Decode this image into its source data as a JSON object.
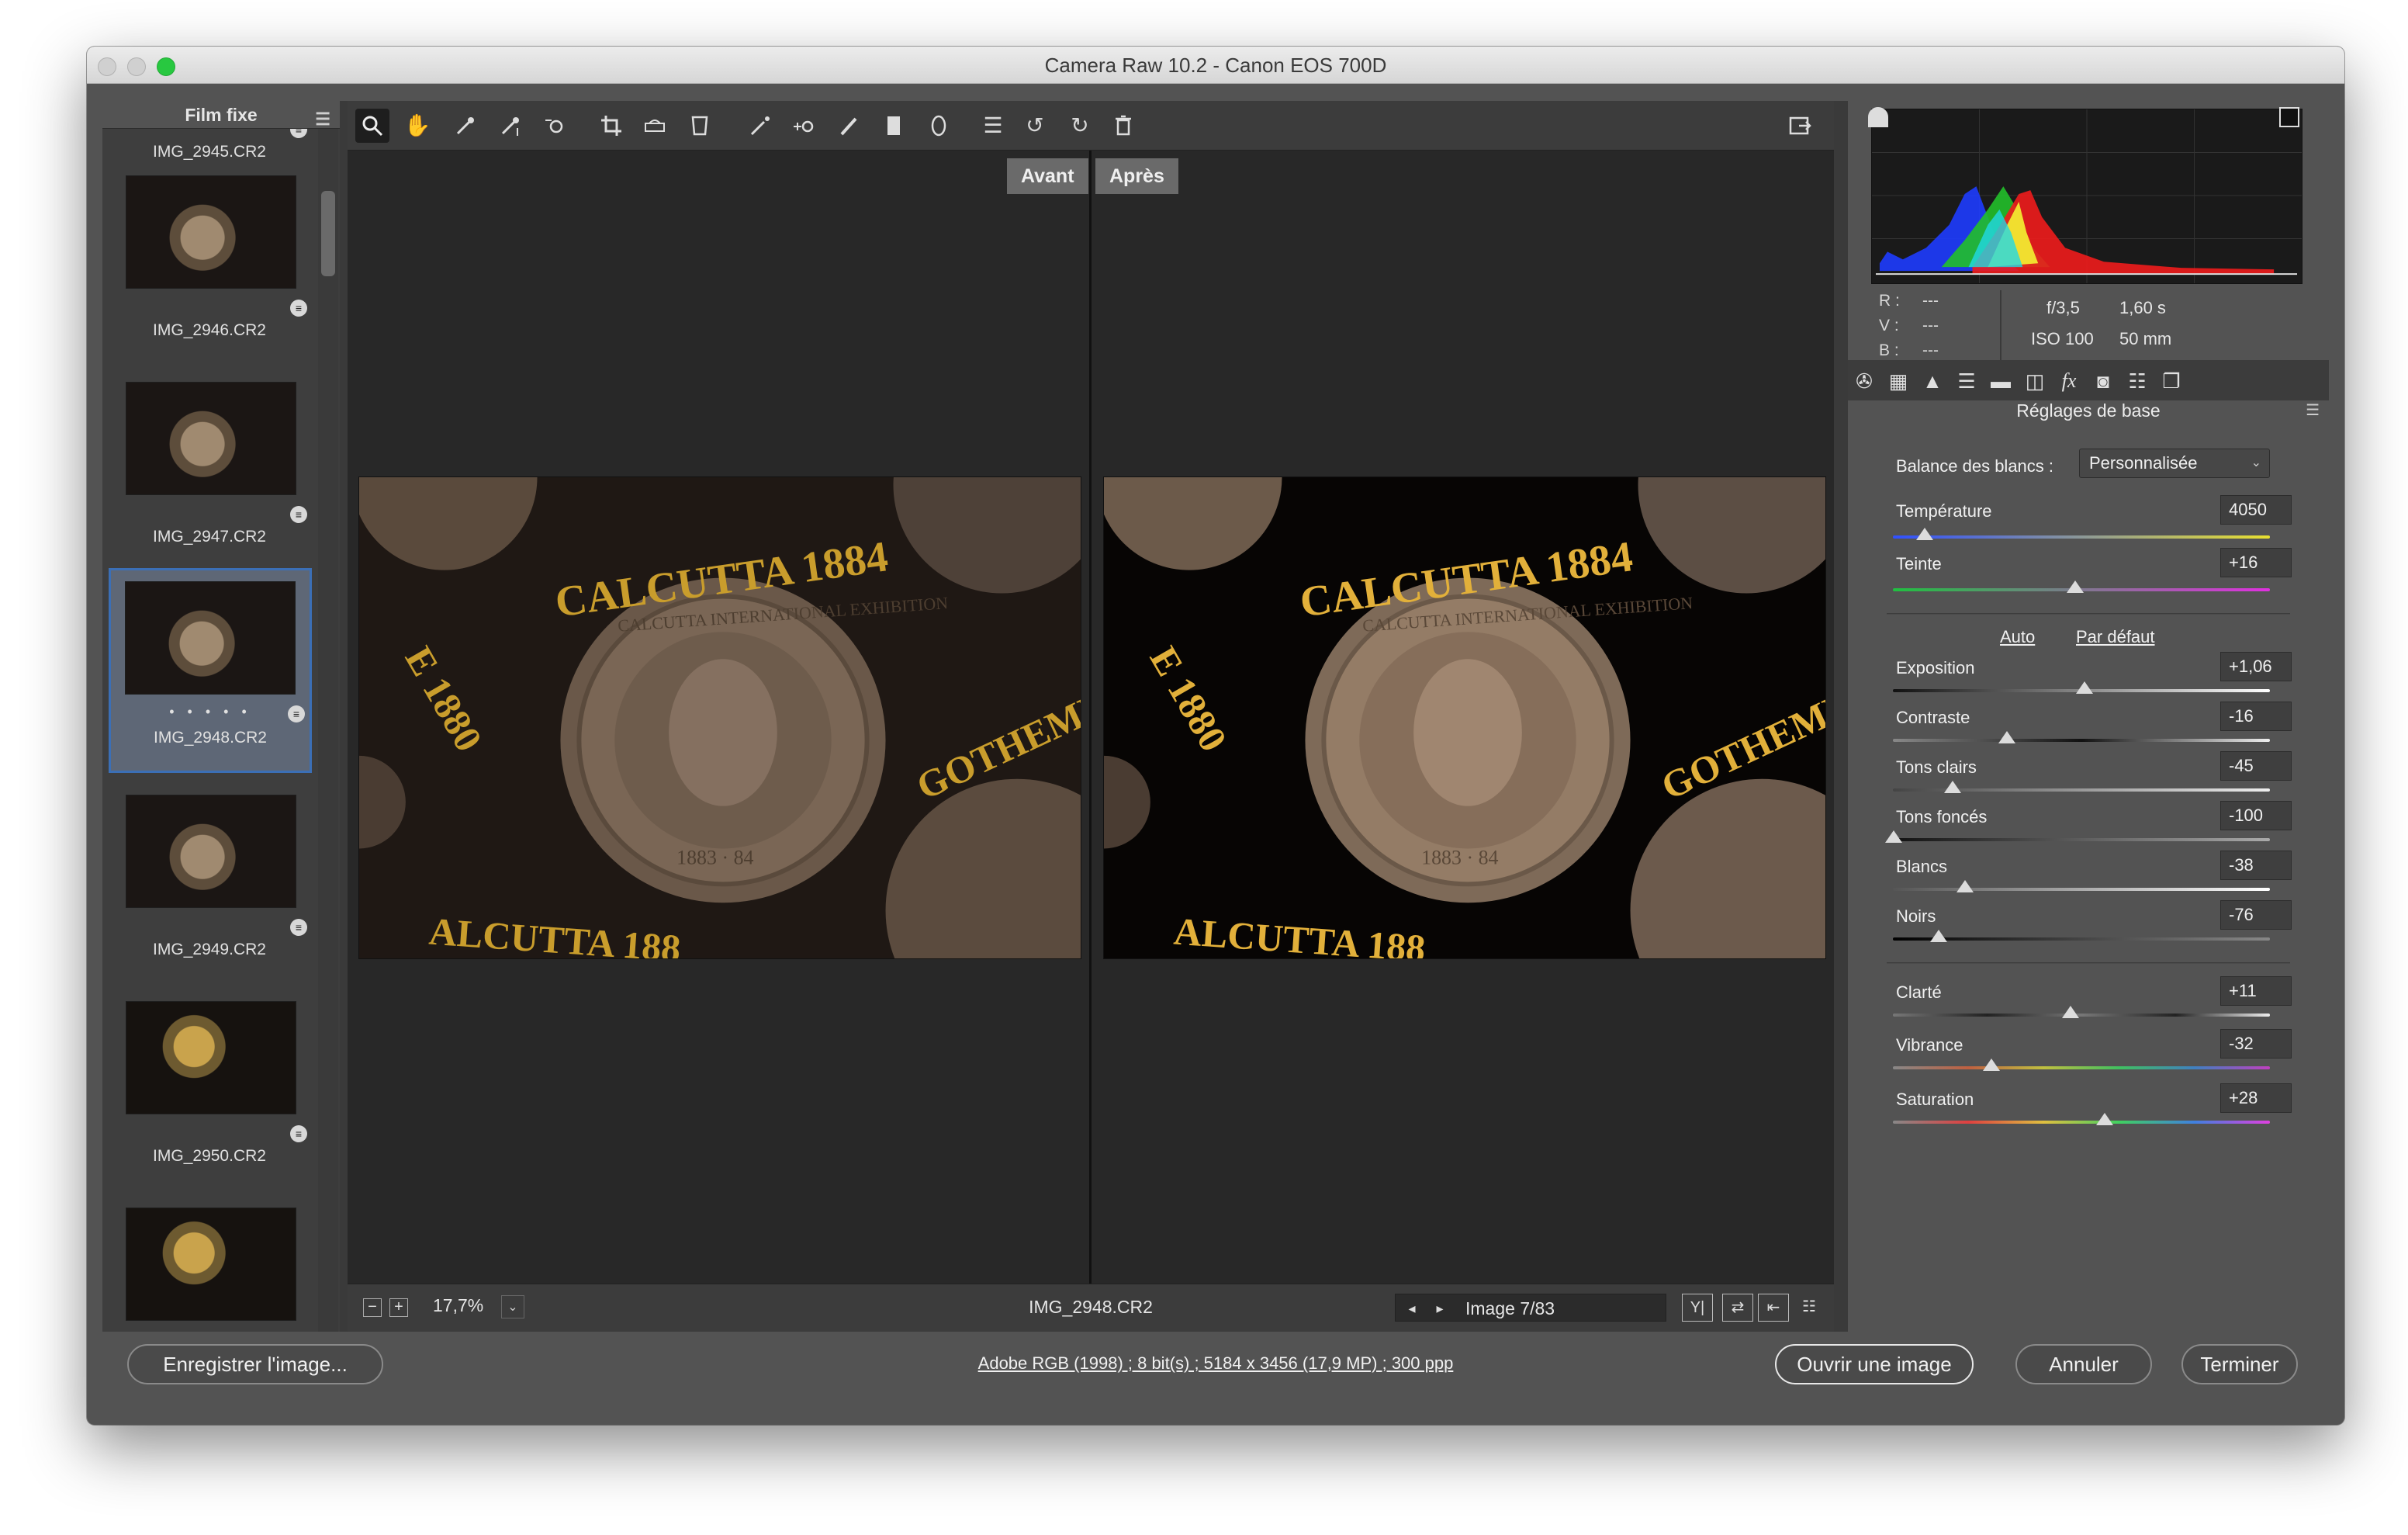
{
  "window": {
    "title": "Camera Raw 10.2  -  Canon EOS 700D"
  },
  "filmstrip": {
    "title": "Film fixe",
    "items": [
      {
        "name": "IMG_2945.CR2"
      },
      {
        "name": "IMG_2946.CR2"
      },
      {
        "name": "IMG_2947.CR2"
      },
      {
        "name": "IMG_2948.CR2",
        "stars": "• • • • •"
      },
      {
        "name": "IMG_2949.CR2"
      },
      {
        "name": "IMG_2950.CR2"
      }
    ]
  },
  "view": {
    "before_label": "Avant",
    "after_label": "Après",
    "photo_text": {
      "top": "CALCUTTA 1884",
      "left": "E 1880",
      "right": "GOTHEMB",
      "bottom": "ALCUTTA 188",
      "ring": "CALCUTTA INTERNATIONAL EXHIBITION",
      "date": "1883 · 84"
    }
  },
  "bottombar": {
    "zoom": "17,7%",
    "filename": "IMG_2948.CR2",
    "image_counter": "Image 7/83"
  },
  "histogram": {
    "r_label": "R :",
    "r_value": "---",
    "v_label": "V :",
    "v_value": "---",
    "b_label": "B :",
    "b_value": "---",
    "aperture": "f/3,5",
    "shutter": "1,60 s",
    "iso": "ISO 100",
    "focal": "50 mm"
  },
  "panel": {
    "section_title": "Réglages de base",
    "wb_label": "Balance des blancs :",
    "wb_value": "Personnalisée",
    "auto_link": "Auto",
    "default_link": "Par défaut",
    "sliders": {
      "temperature": {
        "label": "Température",
        "value": "4050"
      },
      "teinte": {
        "label": "Teinte",
        "value": "+16"
      },
      "exposition": {
        "label": "Exposition",
        "value": "+1,06"
      },
      "contraste": {
        "label": "Contraste",
        "value": "-16"
      },
      "tons_clairs": {
        "label": "Tons clairs",
        "value": "-45"
      },
      "tons_fonces": {
        "label": "Tons foncés",
        "value": "-100"
      },
      "blancs": {
        "label": "Blancs",
        "value": "-38"
      },
      "noirs": {
        "label": "Noirs",
        "value": "-76"
      },
      "clarte": {
        "label": "Clarté",
        "value": "+11"
      },
      "vibrance": {
        "label": "Vibrance",
        "value": "-32"
      },
      "saturation": {
        "label": "Saturation",
        "value": "+28"
      }
    }
  },
  "footer": {
    "save": "Enregistrer l'image...",
    "info": "Adobe RGB (1998) ; 8 bit(s) ; 5184 x 3456 (17,9 MP) ; 300 ppp",
    "open": "Ouvrir une image",
    "cancel": "Annuler",
    "done": "Terminer"
  },
  "colors": {
    "selection": "#3b6fb6",
    "panel_bg": "#535353",
    "canvas_bg": "#282828",
    "gold_text": "#d9a92a"
  }
}
